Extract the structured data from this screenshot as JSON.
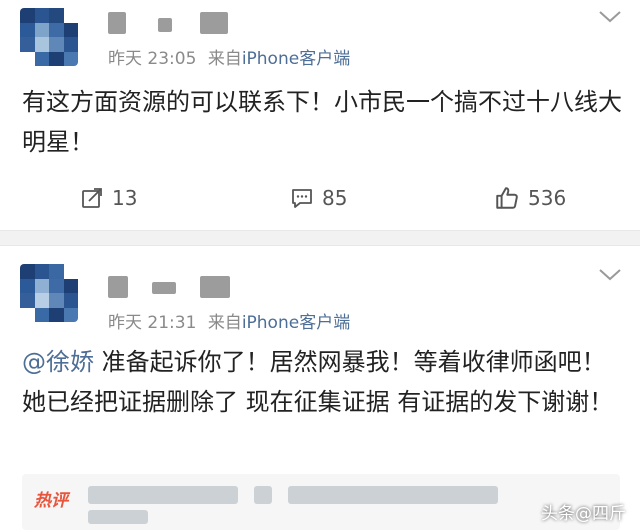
{
  "post1": {
    "time": "昨天 23:05",
    "source_prefix": "来自",
    "source": "iPhone客户端",
    "text": "有这方面资源的可以联系下！小市民一个搞不过十八线大明星！",
    "actions": {
      "repost_count": "13",
      "comment_count": "85",
      "like_count": "536"
    }
  },
  "post2": {
    "time": "昨天 21:31",
    "source_prefix": "来自",
    "source": "iPhone客户端",
    "mention": "@徐娇",
    "text": " 准备起诉你了！居然网暴我！等着收律师函吧！她已经把证据删除了 现在征集证据 有证据的发下谢谢！",
    "hot_comment_tag": "热评"
  },
  "watermark": "头条@四斤",
  "colors": {
    "link": "#4d6e96",
    "meta": "#8a8a8a",
    "hot_tag": "#e8553d",
    "divider": "#f2f2f2"
  },
  "icons": [
    "chevron-down-icon",
    "repost-icon",
    "comment-icon",
    "like-icon"
  ]
}
